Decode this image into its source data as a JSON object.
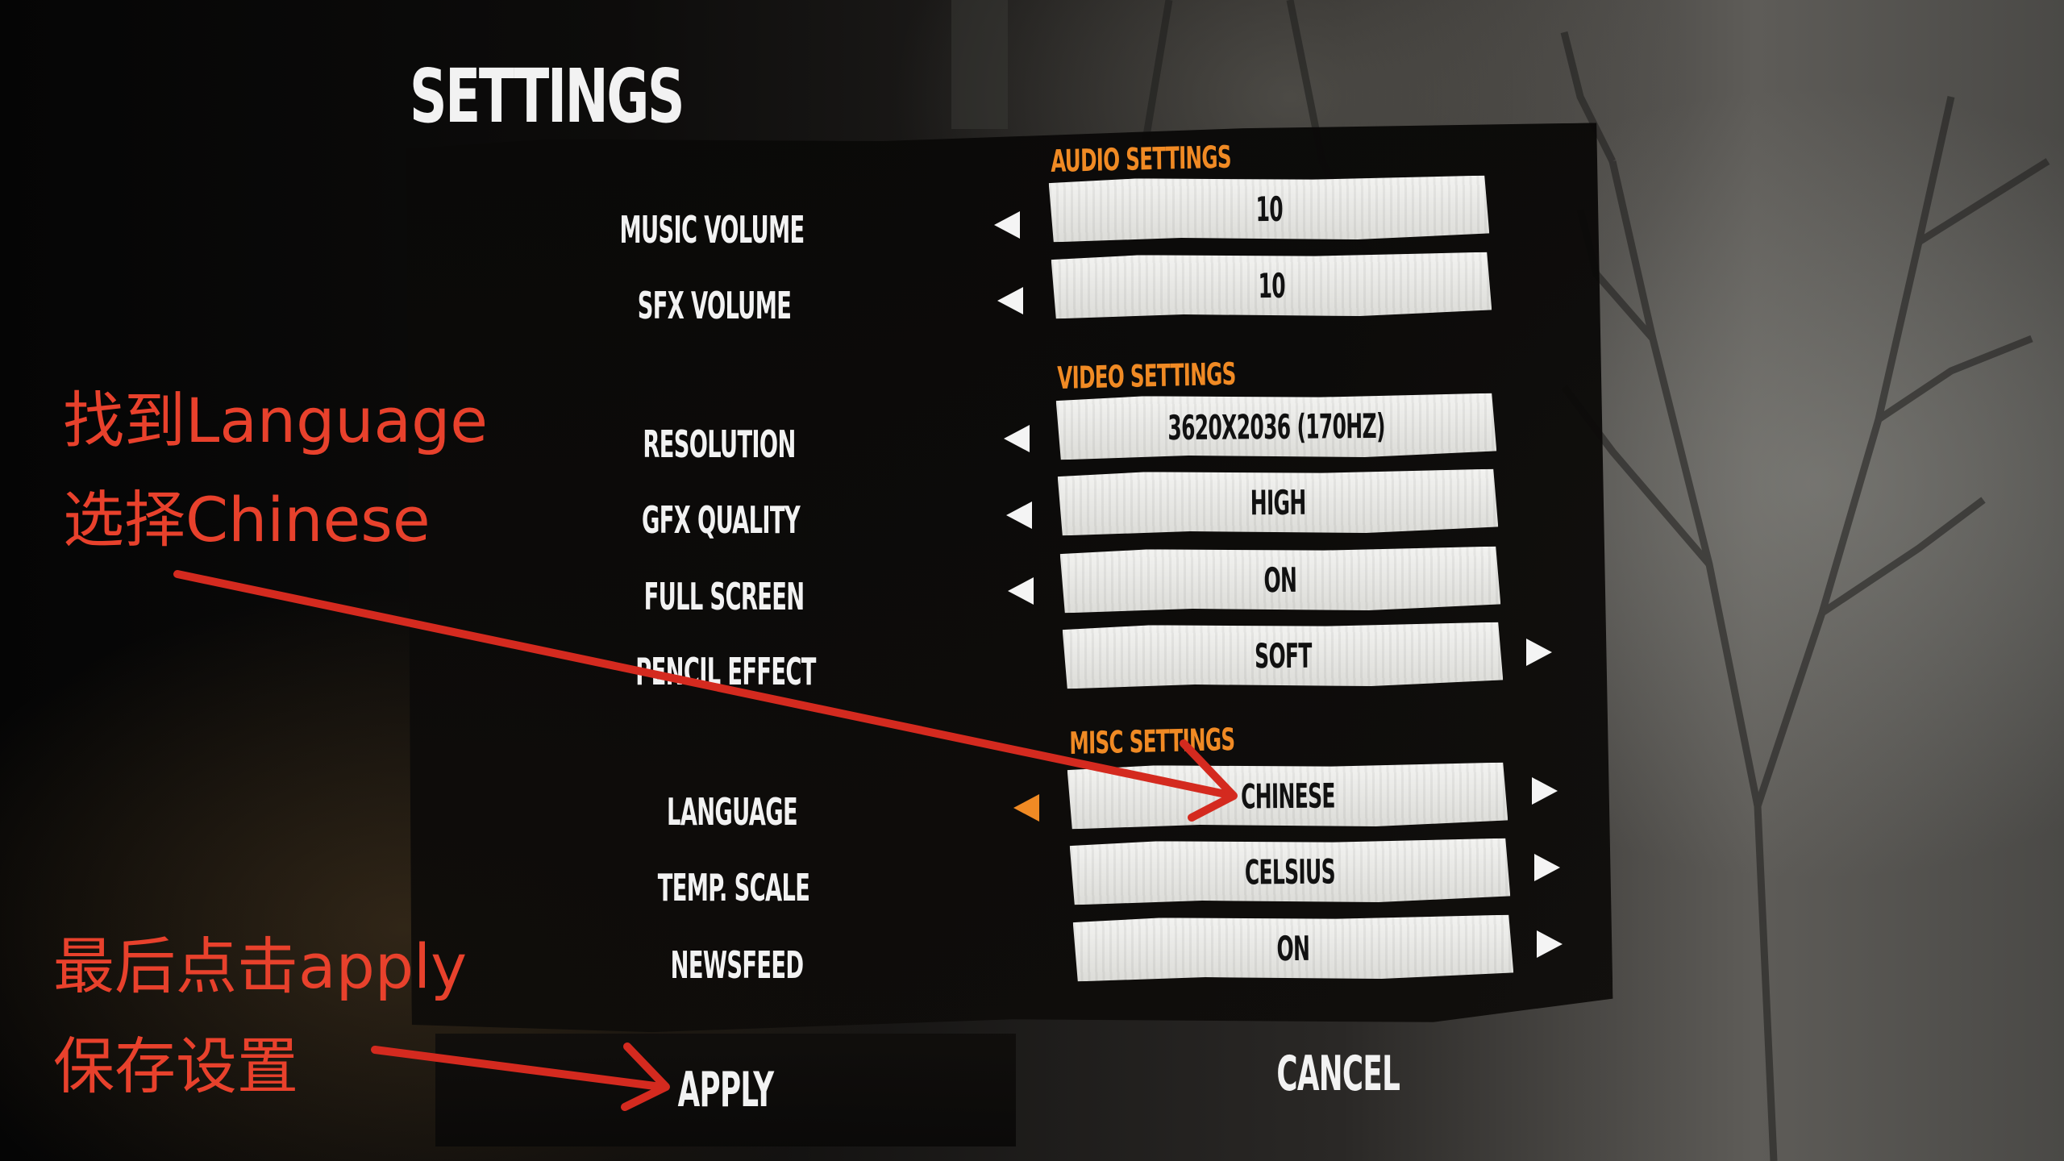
{
  "title": "SETTINGS",
  "sections": {
    "audio": "AUDIO SETTINGS",
    "video": "VIDEO SETTINGS",
    "misc": "MISC SETTINGS"
  },
  "settings": {
    "music_volume": {
      "label": "MUSIC VOLUME",
      "value": "10"
    },
    "sfx_volume": {
      "label": "SFX VOLUME",
      "value": "10"
    },
    "resolution": {
      "label": "RESOLUTION",
      "value": "3620X2036 (170HZ)"
    },
    "gfx_quality": {
      "label": "GFX QUALITY",
      "value": "HIGH"
    },
    "full_screen": {
      "label": "FULL SCREEN",
      "value": "ON"
    },
    "pencil_effect": {
      "label": "PENCIL EFFECT",
      "value": "SOFT"
    },
    "language": {
      "label": "LANGUAGE",
      "value": "CHINESE"
    },
    "temp_scale": {
      "label": "TEMP. SCALE",
      "value": "CELSIUS"
    },
    "newsfeed": {
      "label": "NEWSFEED",
      "value": "ON"
    }
  },
  "buttons": {
    "apply": "APPLY",
    "cancel": "CANCEL"
  },
  "annotations": {
    "line1": "找到Language",
    "line2": "选择Chinese",
    "line3": "最后点击apply",
    "line4": "保存设置"
  },
  "colors": {
    "accent_orange": "#f08a24",
    "annotation_red": "#e8412c"
  }
}
